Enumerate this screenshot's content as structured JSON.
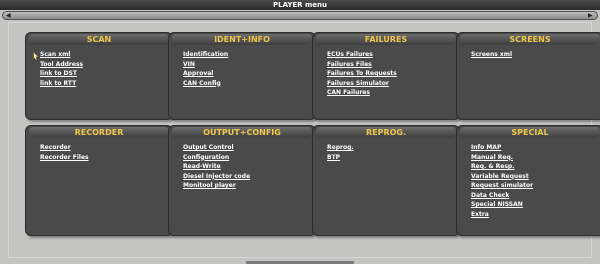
{
  "window": {
    "title": "PLAYER menu"
  },
  "panels": [
    {
      "title": "SCAN",
      "items": [
        "Scan xml",
        "Tool Address",
        "link to DST",
        "link to RTT"
      ]
    },
    {
      "title": "IDENT+INFO",
      "items": [
        "Identification",
        "VIN",
        "Approval",
        "CAN Config"
      ]
    },
    {
      "title": "FAILURES",
      "items": [
        "ECUs Failures",
        "Failures Files",
        "Failures To Requests",
        "Failures Simulator",
        "CAN Failures"
      ]
    },
    {
      "title": "SCREENS",
      "items": [
        "Screens xml"
      ]
    },
    {
      "title": "RECORDER",
      "items": [
        "Recorder",
        "Recorder Files"
      ]
    },
    {
      "title": "OUTPUT+CONFIG",
      "items": [
        "Output Control",
        "Configuration",
        "Read-Write",
        "Diesel Injector code",
        "Monitool player"
      ]
    },
    {
      "title": "REPROG.",
      "items": [
        "Reprog.",
        "BTP"
      ]
    },
    {
      "title": "SPECIAL",
      "items": [
        "Info MAP",
        "Manual Req.",
        "Req. & Resp.",
        "Variable Request",
        "Request simulator",
        "Data Check",
        "Special NISSAN",
        "Extra"
      ]
    }
  ],
  "colors": {
    "panel_bg": "#4a4a4a",
    "header_text": "#f0c64a",
    "link_text": "#ffffff",
    "page_bg": "#c4c4c2"
  }
}
